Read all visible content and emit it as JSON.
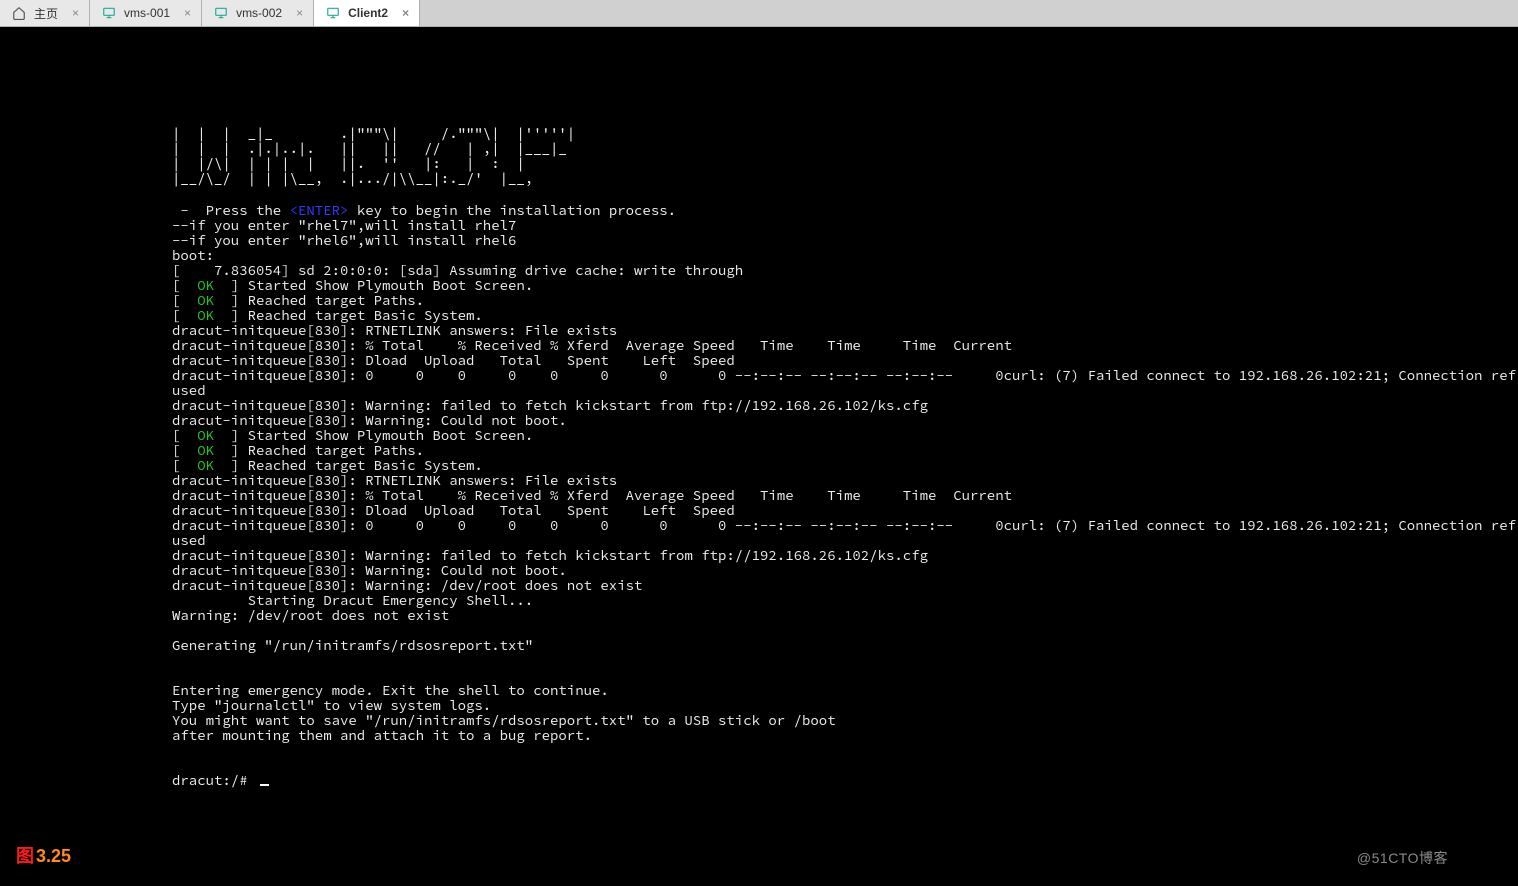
{
  "tabs": [
    {
      "label": "主页",
      "icon": "home",
      "active": false
    },
    {
      "label": "vms-001",
      "icon": "monitor",
      "active": false
    },
    {
      "label": "vms-002",
      "icon": "monitor",
      "active": false
    },
    {
      "label": "Client2",
      "icon": "monitor",
      "active": true
    }
  ],
  "close_glyph": "×",
  "ascii_art": "|  |  |  _|_        .|\"\"\"\\|     /.\"\"\"\\|  |'''''|\n|  |  |  .|.|..|.   ||   ||   //   | ,|  |___|_\n|  |/\\|  | | |  |   ||.  ''   |:   |  :  |\n|__/\\_/  | | |\\__,  .|.../|\\\\__|:._/'  |__,",
  "term": {
    "l1_a": " -  Press the ",
    "enter": "<ENTER>",
    "l1_b": " key to begin the installation process.",
    "l2": "--if you enter \"rhel7\",will install rhel7",
    "l3": "--if you enter \"rhel6\",will install rhel6",
    "l4": "boot:",
    "l5": "[    7.836054] sd 2:0:0:0: [sda] Assuming drive cache: write through",
    "ok_open": "[  ",
    "ok": "OK",
    "ok6": "  ] Started Show Plymouth Boot Screen.",
    "ok7": "  ] Reached target Paths.",
    "ok8": "  ] Reached target Basic System.",
    "l9": "dracut-initqueue[830]: RTNETLINK answers: File exists",
    "l10": "dracut-initqueue[830]: % Total    % Received % Xferd  Average Speed   Time    Time     Time  Current",
    "l11": "dracut-initqueue[830]: Dload  Upload   Total   Spent    Left  Speed",
    "l12": "dracut-initqueue[830]: 0     0    0     0    0     0      0      0 --:--:-- --:--:-- --:--:--     0curl: (7) Failed connect to 192.168.26.102:21; Connection ref",
    "l13": "used",
    "l14": "dracut-initqueue[830]: Warning: failed to fetch kickstart from ftp://192.168.26.102/ks.cfg",
    "l15": "dracut-initqueue[830]: Warning: Could not boot.",
    "ok16": "  ] Started Show Plymouth Boot Screen.",
    "ok17": "  ] Reached target Paths.",
    "ok18": "  ] Reached target Basic System.",
    "l19": "dracut-initqueue[830]: RTNETLINK answers: File exists",
    "l20": "dracut-initqueue[830]: % Total    % Received % Xferd  Average Speed   Time    Time     Time  Current",
    "l21": "dracut-initqueue[830]: Dload  Upload   Total   Spent    Left  Speed",
    "l22": "dracut-initqueue[830]: 0     0    0     0    0     0      0      0 --:--:-- --:--:-- --:--:--     0curl: (7) Failed connect to 192.168.26.102:21; Connection ref",
    "l23": "used",
    "l24": "dracut-initqueue[830]: Warning: failed to fetch kickstart from ftp://192.168.26.102/ks.cfg",
    "l25": "dracut-initqueue[830]: Warning: Could not boot.",
    "l26": "dracut-initqueue[830]: Warning: /dev/root does not exist",
    "l27": "         Starting Dracut Emergency Shell...",
    "l28": "Warning: /dev/root does not exist",
    "l30": "Generating \"/run/initramfs/rdsosreport.txt\"",
    "l33": "Entering emergency mode. Exit the shell to continue.",
    "l34": "Type \"journalctl\" to view system logs.",
    "l35": "You might want to save \"/run/initramfs/rdsosreport.txt\" to a USB stick or /boot",
    "l36": "after mounting them and attach it to a bug report.",
    "prompt": "dracut:/# "
  },
  "figure": {
    "prefix": "图",
    "number": "3.25"
  },
  "watermark": "@51CTO博客"
}
